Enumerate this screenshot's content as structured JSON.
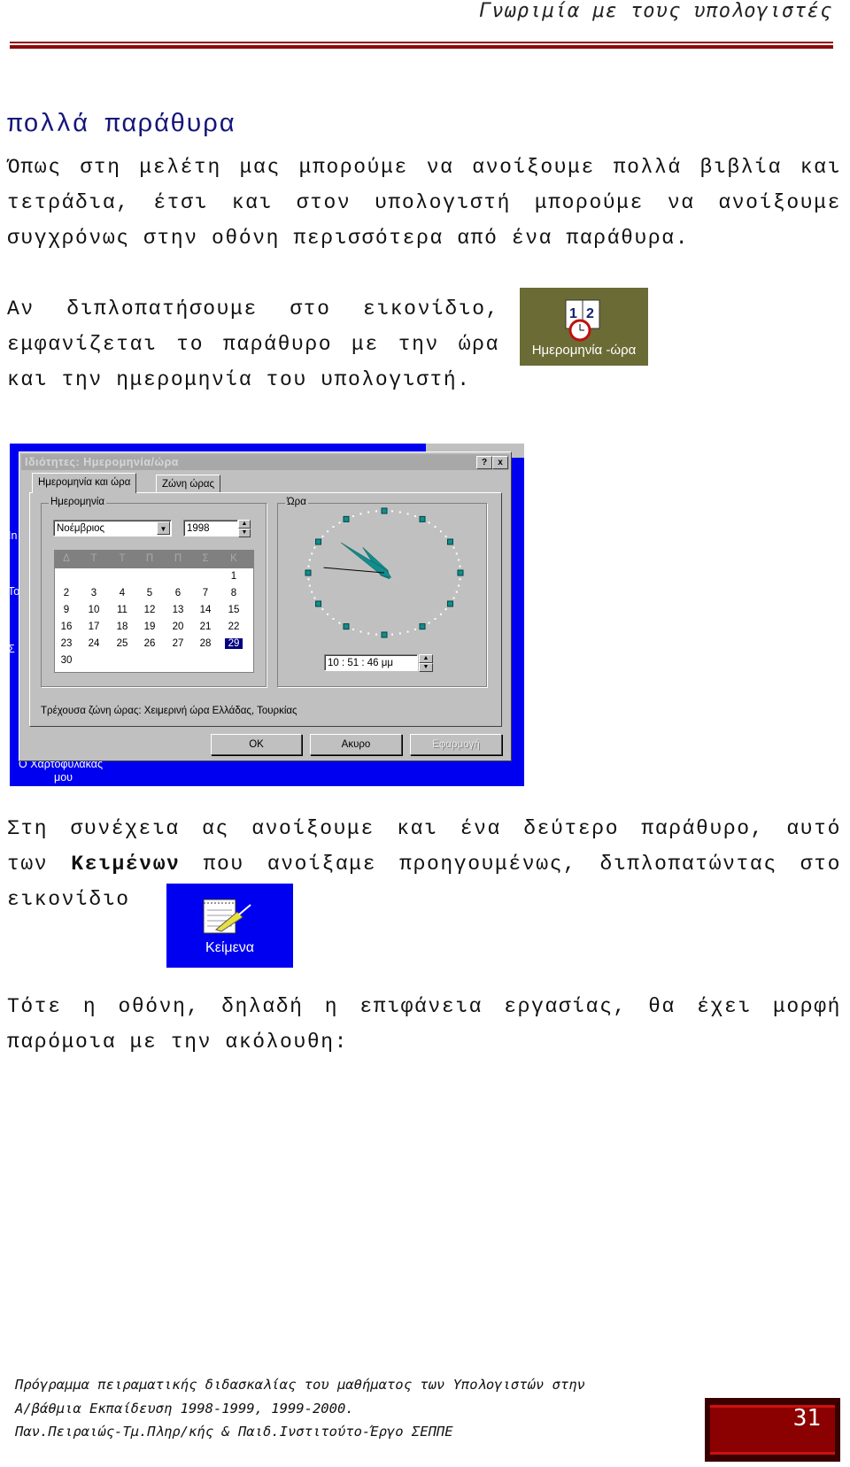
{
  "header": {
    "running_title": "Γνωριμία με τους υπολογιστές"
  },
  "section": {
    "title": "πολλά παράθυρα"
  },
  "paragraphs": [
    {
      "lines": [
        "Όπως στη μελέτη μας μπορούμε να ανοίξουμε πολλά βιβλία και",
        "τετράδια, έτσι και στον υπολογιστή μπορούμε να ανοίξουμε",
        "συγχρόνως στην οθόνη περισσότερα από ένα παράθυρα."
      ]
    },
    {
      "lines": [
        "Αν  διπλοπατήσουμε στο εικονίδιο,",
        "εμφανίζεται το παράθυρο με την ώρα",
        "και την ημερομηνία του υπολογιστή."
      ]
    },
    {
      "line1": "Στη συνέχεια ας ανοίξουμε και ένα δεύτερο παράθυρο, αυτό",
      "line2_pre": "των ",
      "line2_bold": "Κειμένων",
      "line2_post": " που ανοίξαμε προηγουμένως, διπλοπατώντας στο",
      "line3": "εικονίδιο"
    },
    {
      "lines": [
        "Τότε η οθόνη, δηλαδή η επιφάνεια εργασίας, θα έχει μορφή",
        "παρόμοια με την ακόλουθη:"
      ]
    }
  ],
  "icons": {
    "datetime": {
      "label": "Ημερομηνία -ώρα",
      "bg": "#6b6b35"
    },
    "texts": {
      "label": "Κείμενα",
      "bg": "#0000f0"
    }
  },
  "dialog": {
    "title": "Ιδιότητες: Ημερομηνία/ώρα",
    "help": "?",
    "close": "x",
    "tabs": [
      "Ημερομηνία και ώρα",
      "Ζώνη ώρας"
    ],
    "date_group": "Ημερομηνία",
    "month": "Νοέμβριος",
    "year": "1998",
    "weekdays": [
      "Δ",
      "Τ",
      "Τ",
      "Π",
      "Π",
      "Σ",
      "Κ"
    ],
    "days_first_weekday_index": 6,
    "days_in_month": 30,
    "selected_day": 29,
    "time_group": "Ώρα",
    "clock_time": "10:51:46",
    "time": "10 : 51 : 46 μμ",
    "timezone": "Τρέχουσα ζώνη ώρας:  Χειμερινή ώρα Ελλάδας, Τουρκίας",
    "buttons": {
      "ok": "OK",
      "cancel": "Ακυρο",
      "apply": "Εφαρμογή"
    },
    "desktop_label_1": "Ο Χαρτοφύλακάς",
    "desktop_label_2": "μου",
    "desktop_edge": [
      "In",
      "Το",
      "Σ"
    ]
  },
  "footer": {
    "lines": [
      "Πρόγραμμα πειραματικής διδασκαλίας του μαθήματος των Υπολογιστών στην",
      "Α/βάθμια Εκπαίδευση 1998-1999, 1999-2000.",
      "Παν.Πειραιώς-Τμ.Πληρ/κής & Παιδ.Ινστιτούτο-Έργο ΣΕΠΠΕ"
    ],
    "page_number": "31"
  },
  "colors": {
    "rule": "#8b0a0a",
    "heading": "#15157a",
    "desktop": "#0000f0",
    "clock_teal": "#128c8c"
  }
}
